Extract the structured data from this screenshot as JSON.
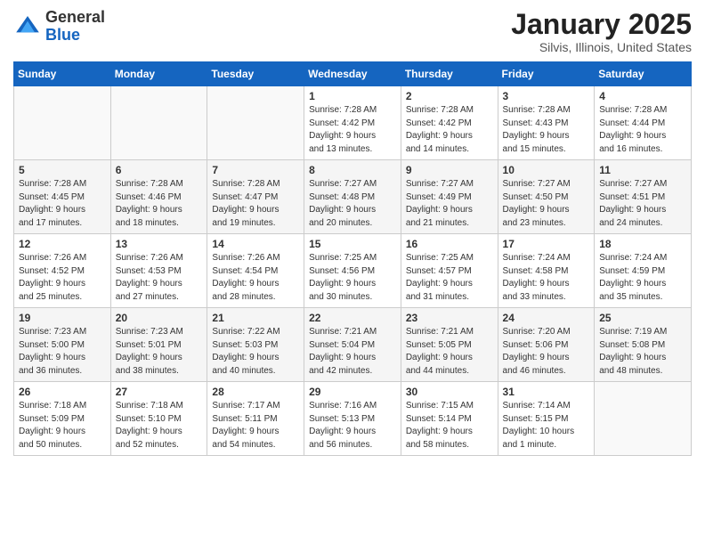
{
  "header": {
    "logo_general": "General",
    "logo_blue": "Blue",
    "month_title": "January 2025",
    "location": "Silvis, Illinois, United States"
  },
  "days_of_week": [
    "Sunday",
    "Monday",
    "Tuesday",
    "Wednesday",
    "Thursday",
    "Friday",
    "Saturday"
  ],
  "weeks": [
    {
      "even": false,
      "days": [
        {
          "num": "",
          "info": "",
          "empty": true
        },
        {
          "num": "",
          "info": "",
          "empty": true
        },
        {
          "num": "",
          "info": "",
          "empty": true
        },
        {
          "num": "1",
          "info": "Sunrise: 7:28 AM\nSunset: 4:42 PM\nDaylight: 9 hours\nand 13 minutes.",
          "empty": false
        },
        {
          "num": "2",
          "info": "Sunrise: 7:28 AM\nSunset: 4:42 PM\nDaylight: 9 hours\nand 14 minutes.",
          "empty": false
        },
        {
          "num": "3",
          "info": "Sunrise: 7:28 AM\nSunset: 4:43 PM\nDaylight: 9 hours\nand 15 minutes.",
          "empty": false
        },
        {
          "num": "4",
          "info": "Sunrise: 7:28 AM\nSunset: 4:44 PM\nDaylight: 9 hours\nand 16 minutes.",
          "empty": false
        }
      ]
    },
    {
      "even": true,
      "days": [
        {
          "num": "5",
          "info": "Sunrise: 7:28 AM\nSunset: 4:45 PM\nDaylight: 9 hours\nand 17 minutes.",
          "empty": false
        },
        {
          "num": "6",
          "info": "Sunrise: 7:28 AM\nSunset: 4:46 PM\nDaylight: 9 hours\nand 18 minutes.",
          "empty": false
        },
        {
          "num": "7",
          "info": "Sunrise: 7:28 AM\nSunset: 4:47 PM\nDaylight: 9 hours\nand 19 minutes.",
          "empty": false
        },
        {
          "num": "8",
          "info": "Sunrise: 7:27 AM\nSunset: 4:48 PM\nDaylight: 9 hours\nand 20 minutes.",
          "empty": false
        },
        {
          "num": "9",
          "info": "Sunrise: 7:27 AM\nSunset: 4:49 PM\nDaylight: 9 hours\nand 21 minutes.",
          "empty": false
        },
        {
          "num": "10",
          "info": "Sunrise: 7:27 AM\nSunset: 4:50 PM\nDaylight: 9 hours\nand 23 minutes.",
          "empty": false
        },
        {
          "num": "11",
          "info": "Sunrise: 7:27 AM\nSunset: 4:51 PM\nDaylight: 9 hours\nand 24 minutes.",
          "empty": false
        }
      ]
    },
    {
      "even": false,
      "days": [
        {
          "num": "12",
          "info": "Sunrise: 7:26 AM\nSunset: 4:52 PM\nDaylight: 9 hours\nand 25 minutes.",
          "empty": false
        },
        {
          "num": "13",
          "info": "Sunrise: 7:26 AM\nSunset: 4:53 PM\nDaylight: 9 hours\nand 27 minutes.",
          "empty": false
        },
        {
          "num": "14",
          "info": "Sunrise: 7:26 AM\nSunset: 4:54 PM\nDaylight: 9 hours\nand 28 minutes.",
          "empty": false
        },
        {
          "num": "15",
          "info": "Sunrise: 7:25 AM\nSunset: 4:56 PM\nDaylight: 9 hours\nand 30 minutes.",
          "empty": false
        },
        {
          "num": "16",
          "info": "Sunrise: 7:25 AM\nSunset: 4:57 PM\nDaylight: 9 hours\nand 31 minutes.",
          "empty": false
        },
        {
          "num": "17",
          "info": "Sunrise: 7:24 AM\nSunset: 4:58 PM\nDaylight: 9 hours\nand 33 minutes.",
          "empty": false
        },
        {
          "num": "18",
          "info": "Sunrise: 7:24 AM\nSunset: 4:59 PM\nDaylight: 9 hours\nand 35 minutes.",
          "empty": false
        }
      ]
    },
    {
      "even": true,
      "days": [
        {
          "num": "19",
          "info": "Sunrise: 7:23 AM\nSunset: 5:00 PM\nDaylight: 9 hours\nand 36 minutes.",
          "empty": false
        },
        {
          "num": "20",
          "info": "Sunrise: 7:23 AM\nSunset: 5:01 PM\nDaylight: 9 hours\nand 38 minutes.",
          "empty": false
        },
        {
          "num": "21",
          "info": "Sunrise: 7:22 AM\nSunset: 5:03 PM\nDaylight: 9 hours\nand 40 minutes.",
          "empty": false
        },
        {
          "num": "22",
          "info": "Sunrise: 7:21 AM\nSunset: 5:04 PM\nDaylight: 9 hours\nand 42 minutes.",
          "empty": false
        },
        {
          "num": "23",
          "info": "Sunrise: 7:21 AM\nSunset: 5:05 PM\nDaylight: 9 hours\nand 44 minutes.",
          "empty": false
        },
        {
          "num": "24",
          "info": "Sunrise: 7:20 AM\nSunset: 5:06 PM\nDaylight: 9 hours\nand 46 minutes.",
          "empty": false
        },
        {
          "num": "25",
          "info": "Sunrise: 7:19 AM\nSunset: 5:08 PM\nDaylight: 9 hours\nand 48 minutes.",
          "empty": false
        }
      ]
    },
    {
      "even": false,
      "days": [
        {
          "num": "26",
          "info": "Sunrise: 7:18 AM\nSunset: 5:09 PM\nDaylight: 9 hours\nand 50 minutes.",
          "empty": false
        },
        {
          "num": "27",
          "info": "Sunrise: 7:18 AM\nSunset: 5:10 PM\nDaylight: 9 hours\nand 52 minutes.",
          "empty": false
        },
        {
          "num": "28",
          "info": "Sunrise: 7:17 AM\nSunset: 5:11 PM\nDaylight: 9 hours\nand 54 minutes.",
          "empty": false
        },
        {
          "num": "29",
          "info": "Sunrise: 7:16 AM\nSunset: 5:13 PM\nDaylight: 9 hours\nand 56 minutes.",
          "empty": false
        },
        {
          "num": "30",
          "info": "Sunrise: 7:15 AM\nSunset: 5:14 PM\nDaylight: 9 hours\nand 58 minutes.",
          "empty": false
        },
        {
          "num": "31",
          "info": "Sunrise: 7:14 AM\nSunset: 5:15 PM\nDaylight: 10 hours\nand 1 minute.",
          "empty": false
        },
        {
          "num": "",
          "info": "",
          "empty": true
        }
      ]
    }
  ]
}
